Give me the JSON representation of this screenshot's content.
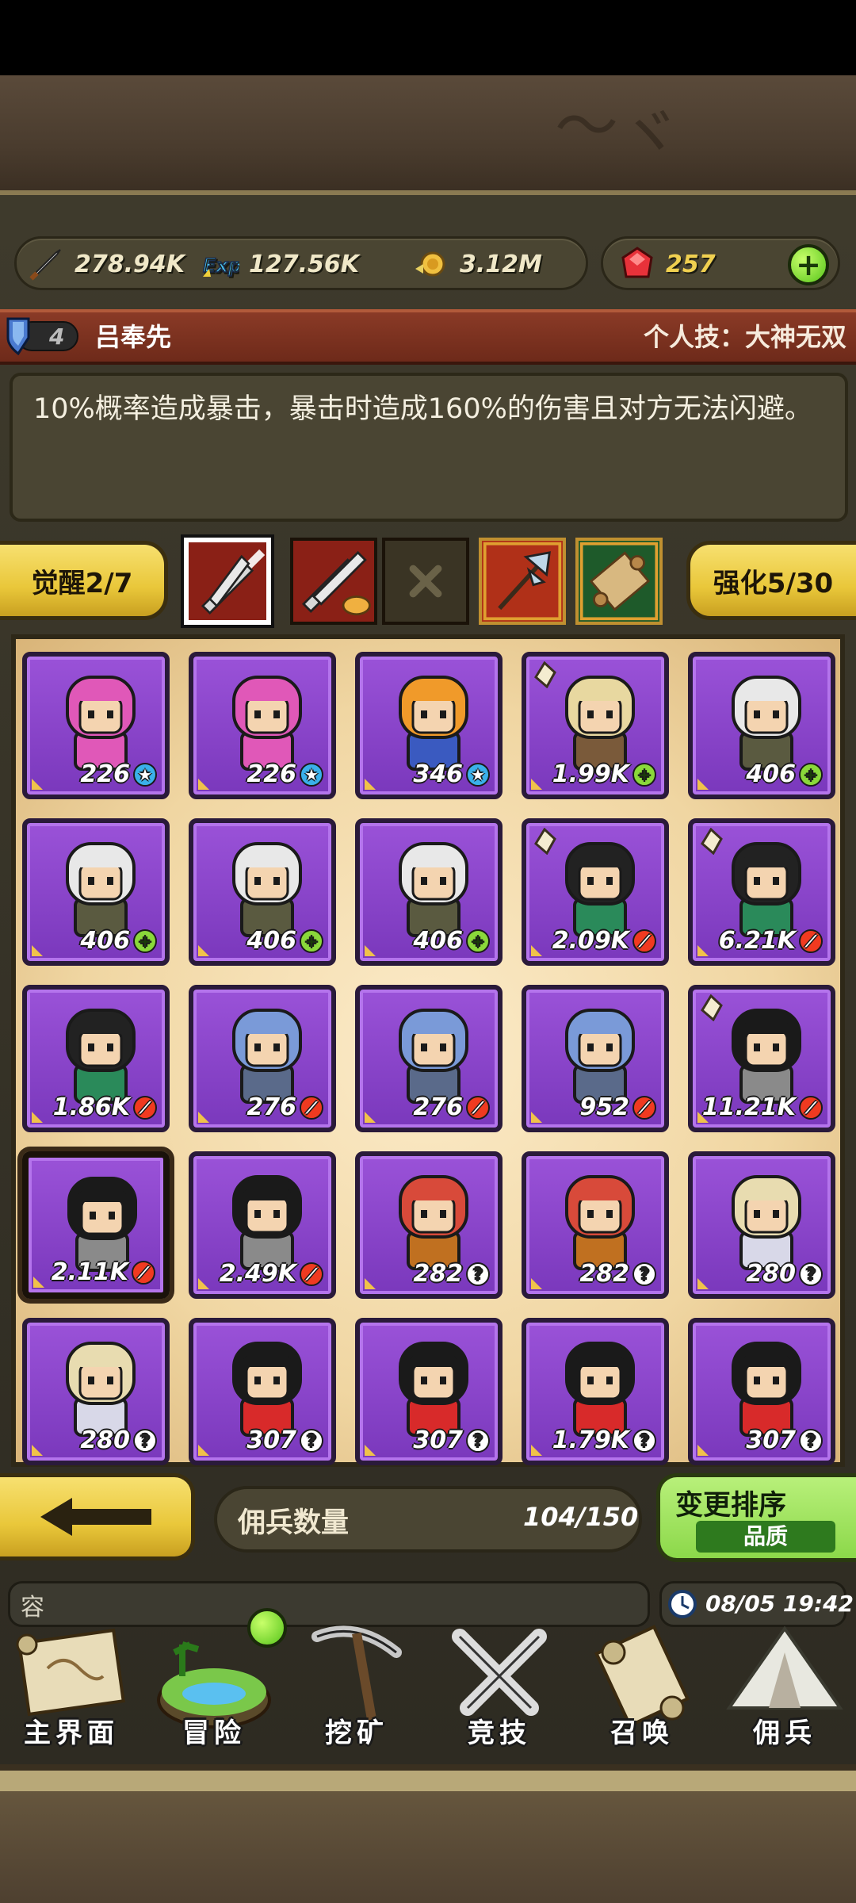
{
  "currency": {
    "attack": "278.94K",
    "exp": "127.56K",
    "gold": "3.12M",
    "gems": "257"
  },
  "hero": {
    "level_badge": "4",
    "name": "吕奉先",
    "skill_label": "个人技：大神无双",
    "skill_desc": "10%概率造成暴击，暴击时造成160%的伤害且对方无法闪避。"
  },
  "awaken": {
    "label": "觉醒2/7"
  },
  "enhance": {
    "label": "强化5/30"
  },
  "slots": [
    "crossed-swords-icon",
    "swords-handshake-icon",
    "empty-slot-x-icon",
    "halberd-icon",
    "scroll-icon"
  ],
  "mercenaries": [
    {
      "value": "226",
      "badge": "star",
      "char": "pink-hood"
    },
    {
      "value": "226",
      "badge": "star",
      "char": "pink-hood"
    },
    {
      "value": "346",
      "badge": "star",
      "char": "orange-hair"
    },
    {
      "value": "1.99K",
      "badge": "plus",
      "char": "horse-rider",
      "corner": true
    },
    {
      "value": "406",
      "badge": "plus",
      "char": "white-hair"
    },
    {
      "value": "406",
      "badge": "plus",
      "char": "white-hair"
    },
    {
      "value": "406",
      "badge": "plus",
      "char": "white-hair"
    },
    {
      "value": "406",
      "badge": "plus",
      "char": "white-hair"
    },
    {
      "value": "2.09K",
      "badge": "atk",
      "char": "green-general",
      "corner": true
    },
    {
      "value": "6.21K",
      "badge": "atk",
      "char": "green-general",
      "corner": true
    },
    {
      "value": "1.86K",
      "badge": "atk",
      "char": "green-general"
    },
    {
      "value": "276",
      "badge": "atk",
      "char": "blue-knight"
    },
    {
      "value": "276",
      "badge": "atk",
      "char": "blue-knight"
    },
    {
      "value": "952",
      "badge": "atk",
      "char": "blue-knight"
    },
    {
      "value": "11.21K",
      "badge": "atk",
      "char": "warlord",
      "corner": true
    },
    {
      "value": "2.11K",
      "badge": "atk",
      "char": "warlord",
      "selected": true
    },
    {
      "value": "2.49K",
      "badge": "atk",
      "char": "warlord"
    },
    {
      "value": "282",
      "badge": "q",
      "char": "red-hair"
    },
    {
      "value": "282",
      "badge": "q",
      "char": "red-hair"
    },
    {
      "value": "280",
      "badge": "q",
      "char": "blonde-girl"
    },
    {
      "value": "280",
      "badge": "q",
      "char": "blonde-girl"
    },
    {
      "value": "307",
      "badge": "q",
      "char": "red-shirt-boy"
    },
    {
      "value": "307",
      "badge": "q",
      "char": "red-shirt-boy"
    },
    {
      "value": "1.79K",
      "badge": "q",
      "char": "red-shirt-boy"
    },
    {
      "value": "307",
      "badge": "q",
      "char": "red-shirt-boy"
    }
  ],
  "bottom": {
    "merc_label": "佣兵数量",
    "merc_count": "104/150",
    "sort_title": "变更排序",
    "sort_sub": "品质"
  },
  "chat": {
    "text": "容"
  },
  "time": "08/05 19:42",
  "nav": [
    {
      "label": "主界面",
      "icon": "map-scroll-icon"
    },
    {
      "label": "冒险",
      "icon": "island-icon"
    },
    {
      "label": "挖矿",
      "icon": "pickaxe-icon"
    },
    {
      "label": "竞技",
      "icon": "crossed-swords-icon"
    },
    {
      "label": "召唤",
      "icon": "summon-scroll-icon"
    },
    {
      "label": "佣兵",
      "icon": "tent-icon"
    }
  ],
  "colors": {
    "card_purple": "#8a46cc",
    "gold_button": "#e9c73a",
    "green_button": "#8cd84a",
    "skill_bar_red": "#7a2e1e"
  }
}
